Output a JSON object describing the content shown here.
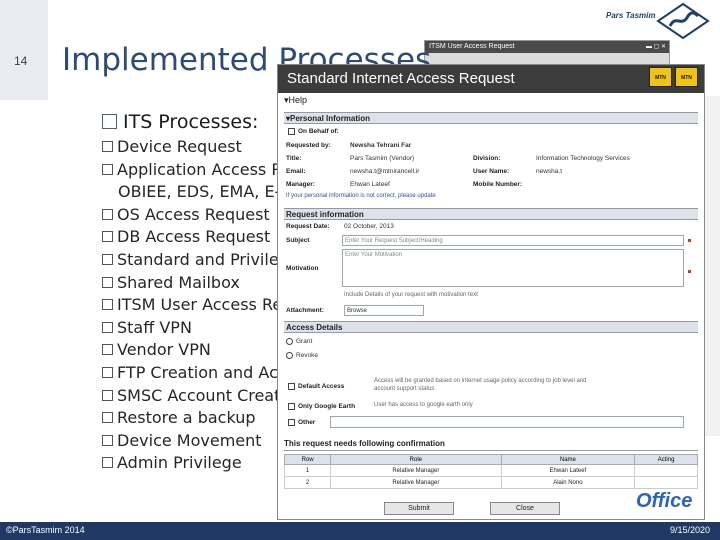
{
  "slide": {
    "number": "14",
    "brand": "Pars Tasmim",
    "title": "Implemented Processes",
    "section": "ITS Processes:",
    "bullets": [
      "Device Request",
      "Application Access Request",
      "OBIEE, EDS, EMA, E-",
      "OS Access Request",
      "DB Access Request",
      "Standard and Privileged",
      "Shared Mailbox",
      "ITSM User Access Request",
      "Staff VPN",
      "Vendor VPN",
      "FTP Creation and Access",
      "SMSC Account Creation",
      "Restore a backup",
      "Device Movement",
      "Admin Privilege"
    ],
    "footer_left": "©ParsTasmim 2014",
    "footer_right": "9/15/2020",
    "office_logo": "Office"
  },
  "bg_window": {
    "title": "ITSM User Access Request"
  },
  "form": {
    "title": "Standard Internet Access Request",
    "logo_label": "MTN",
    "menu_help": "Help",
    "personal_section": "Personal Information",
    "on_behalf": "On Behalf of:",
    "requested_by_label": "Requested by:",
    "requested_by": "Newsha Tehrani Far",
    "title_label": "Title:",
    "title_value": "Pars Tasmim (Vendor)",
    "division_label": "Division:",
    "division": "Information Technology Services",
    "email_label": "Email:",
    "email": "newsha.t@mtnirancell.ir",
    "username_label": "User Name:",
    "username": "newsha.t",
    "manager_label": "Manager:",
    "manager": "Ehwan Lateef",
    "mobile_label": "Mobile Number:",
    "info_link": "If your personal information is not correct, please update",
    "request_section": "Request information",
    "date_label": "Request Date:",
    "date_value": "02 October, 2013",
    "subject_label": "Subject",
    "subject_ph": "Enter Your Request Subject/Heading",
    "motivation_label": "Motivation",
    "motivation_ph": "Enter Your Motivation",
    "motivation_hint": "Include Details of your request with motivation text",
    "attachment_label": "Attachment:",
    "attachment_btn": "Browse",
    "access_section": "Access Details",
    "grant": "Grant",
    "revoke": "Revoke",
    "default_access": "Default Access",
    "default_desc": "Access will be granted based on internet usage policy according to job level and account support status",
    "google_earth": "Only Google Earth",
    "google_desc": "User has access to google earth only",
    "other": "Other",
    "confirm_title": "This request needs following confirmation",
    "confirm_headers": [
      "Row",
      "Role",
      "Name",
      "Acting"
    ],
    "confirm_rows": [
      [
        "1",
        "Relative Manager",
        "Ehwan Lateef",
        ""
      ],
      [
        "2",
        "Relative Manager",
        "Alain Nono",
        ""
      ]
    ],
    "submit": "Submit",
    "close": "Close"
  }
}
